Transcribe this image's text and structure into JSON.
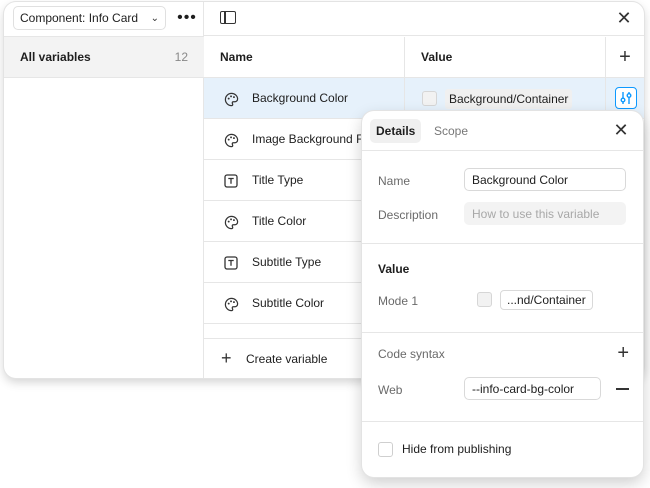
{
  "sidebar": {
    "collection_label": "Component: Info Card",
    "all_variables_label": "All variables",
    "all_variables_count": "12"
  },
  "table": {
    "header_name": "Name",
    "header_value": "Value",
    "rows": [
      {
        "name": "Background Color",
        "icon": "palette-icon",
        "value": "Background/Container",
        "selected": true
      },
      {
        "name": "Image Background Fill",
        "icon": "palette-icon"
      },
      {
        "name": "Title Type",
        "icon": "text-type-icon"
      },
      {
        "name": "Title Color",
        "icon": "palette-icon"
      },
      {
        "name": "Subtitle Type",
        "icon": "text-type-icon"
      },
      {
        "name": "Subtitle Color",
        "icon": "palette-icon"
      }
    ],
    "create_label": "Create variable"
  },
  "details": {
    "tab_details": "Details",
    "tab_scope": "Scope",
    "name_label": "Name",
    "name_value": "Background Color",
    "description_label": "Description",
    "description_placeholder": "How to use this variable",
    "value_section": "Value",
    "mode_label": "Mode 1",
    "mode_value": "...nd/Container",
    "code_syntax_label": "Code syntax",
    "web_label": "Web",
    "web_value": "--info-card-bg-color",
    "hide_label": "Hide from publishing"
  },
  "colors": {
    "accent": "#0d99ff",
    "selected_row": "#e6f1fb"
  }
}
